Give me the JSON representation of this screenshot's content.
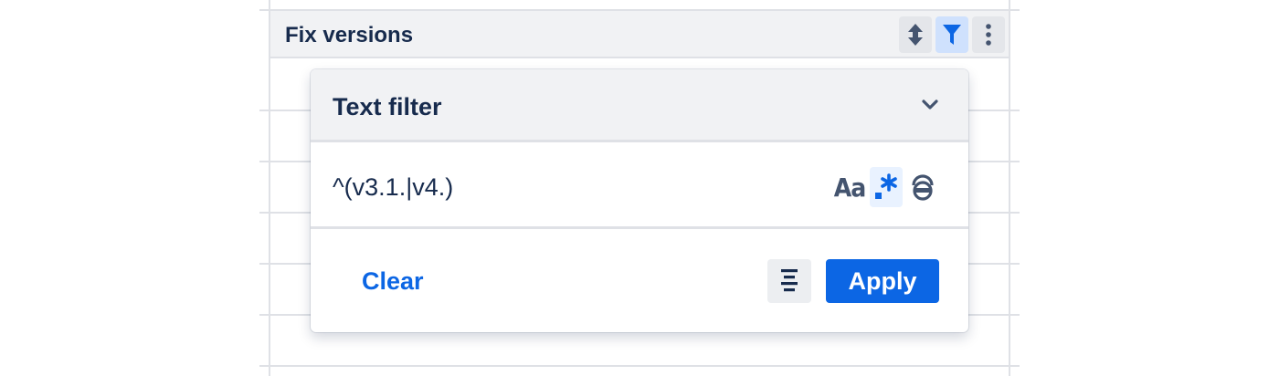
{
  "column": {
    "title": "Fix versions",
    "sort_icon": "sort-icon",
    "filter_icon": "filter-icon",
    "menu_icon": "more-vertical-icon"
  },
  "filter_popup": {
    "title": "Text filter",
    "expand_icon": "chevron-down-icon",
    "input_value": "^(v3.1.|v4.)",
    "options": {
      "match_case_label": "Aa",
      "regex_icon": "regex-icon",
      "regex_active": true,
      "whole_word_icon": "whole-word-icon"
    },
    "clear_label": "Clear",
    "mode_icon": "align-center-icon",
    "apply_label": "Apply"
  },
  "colors": {
    "accent": "#0c66e4",
    "active_bg": "#cfe1fd",
    "text": "#172b4d",
    "subtle_bg": "#f1f2f4"
  }
}
